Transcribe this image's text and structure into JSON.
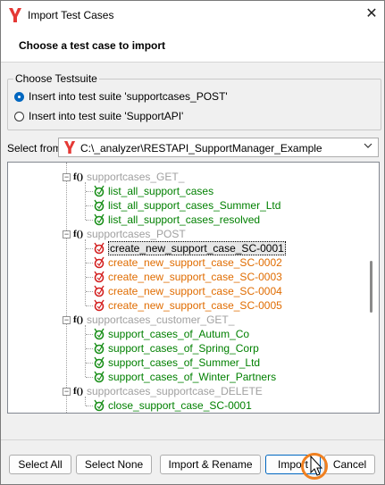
{
  "window": {
    "title": "Import Test Cases",
    "close_glyph": "✕"
  },
  "header": {
    "title": "Choose a test case to import"
  },
  "testsuite_group": {
    "legend": "Choose Testsuite",
    "options": [
      {
        "label": "Insert into test suite 'supportcases_POST'",
        "checked": true
      },
      {
        "label": "Insert into test suite 'SupportAPI'",
        "checked": false
      }
    ]
  },
  "select_from": {
    "label": "Select from",
    "value": "C:\\_analyzer\\RESTAPI_SupportManager_Example"
  },
  "tree": {
    "suites": [
      {
        "name": "supportcases_GET_",
        "cases": [
          {
            "label": "list_all_support_cases",
            "status": "pass"
          },
          {
            "label": "list_all_support_cases_Summer_Ltd",
            "status": "pass"
          },
          {
            "label": "list_all_support_cases_resolved",
            "status": "pass"
          }
        ]
      },
      {
        "name": "supportcases_POST",
        "cases": [
          {
            "label": "create_new_support_case_SC-0001",
            "status": "fail",
            "selected": true
          },
          {
            "label": "create_new_support_case_SC-0002",
            "status": "fail"
          },
          {
            "label": "create_new_support_case_SC-0003",
            "status": "fail"
          },
          {
            "label": "create_new_support_case_SC-0004",
            "status": "fail"
          },
          {
            "label": "create_new_support_case_SC-0005",
            "status": "fail"
          }
        ]
      },
      {
        "name": "supportcases_customer_GET_",
        "cases": [
          {
            "label": "support_cases_of_Autum_Co",
            "status": "pass"
          },
          {
            "label": "support_cases_of_Spring_Corp",
            "status": "pass"
          },
          {
            "label": "support_cases_of_Summer_Ltd",
            "status": "pass"
          },
          {
            "label": "support_cases_of_Winter_Partners",
            "status": "pass"
          }
        ]
      },
      {
        "name": "supportcases_supportcase_DELETE",
        "cases": [
          {
            "label": "close_support_case_SC-0001",
            "status": "pass"
          }
        ]
      }
    ],
    "function_glyph": "f()",
    "expander_glyph": "−"
  },
  "buttons": {
    "select_all": "Select All",
    "select_none": "Select None",
    "import_rename": "Import & Rename",
    "import": "Import",
    "cancel": "Cancel"
  },
  "colors": {
    "pass": "#008000",
    "fail": "#e06c00",
    "suite": "#a0a0a0",
    "accent": "#0067c0",
    "cursor_ring": "#f08020"
  },
  "icons": {
    "app": "app-logo-icon",
    "pass": "green-test-icon",
    "fail": "red-test-icon",
    "dropdown": "chevron-down-icon"
  }
}
